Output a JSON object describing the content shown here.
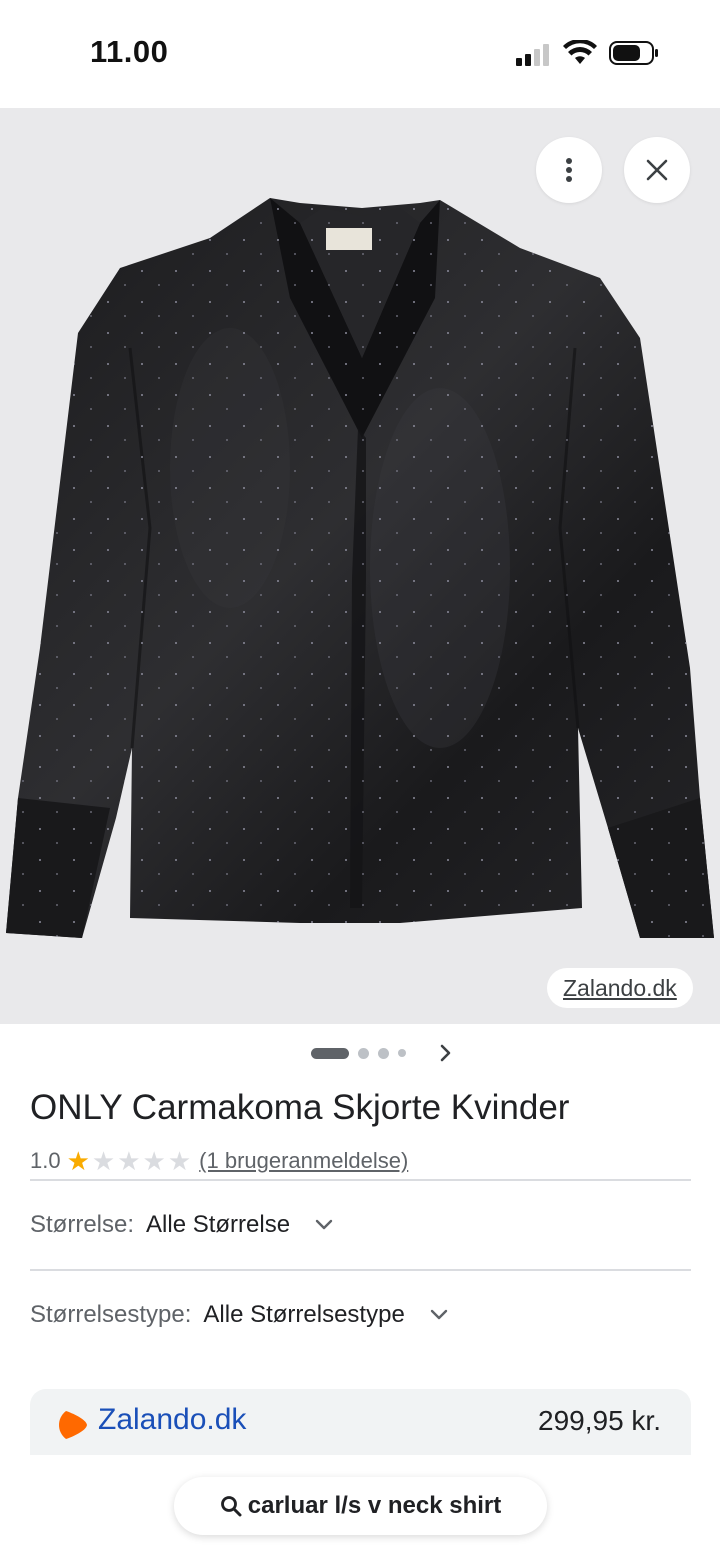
{
  "status_bar": {
    "time": "11.00",
    "icons": [
      "cellular-signal-icon",
      "wifi-icon",
      "battery-icon"
    ]
  },
  "hero": {
    "image": "black-satin-v-neck-shirt",
    "more_icon": "more-vert-icon",
    "close_icon": "close-icon",
    "source_label": "Zalando.dk",
    "carousel_next_icon": "chevron-right-icon",
    "carousel_count": 4,
    "carousel_active_index": 0
  },
  "product": {
    "title": "ONLY Carmakoma Skjorte Kvinder",
    "rating_value": "1.0",
    "rating_stars": 1,
    "rating_max": 5,
    "review_link": "(1 brugeranmeldelse)"
  },
  "filters": [
    {
      "label": "Størrelse:",
      "value": "Alle Størrelse"
    },
    {
      "label": "Størrelsestype:",
      "value": "Alle Størrelsestype"
    }
  ],
  "offer": {
    "merchant": "Zalando.dk",
    "price": "299,95 kr.",
    "brand_color": "#ff6900"
  },
  "search_chip": {
    "icon": "search-icon",
    "query": "carluar l/s v neck shirt"
  },
  "colors": {
    "link_blue": "#1a4fb8",
    "star_gold": "#f9ab00",
    "text_secondary": "#5f6368"
  }
}
